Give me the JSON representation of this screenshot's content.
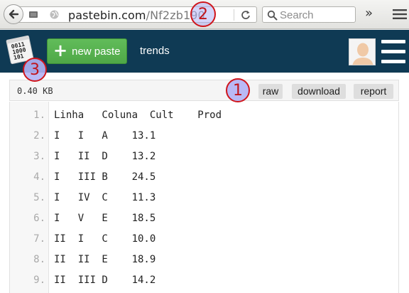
{
  "browser": {
    "url_domain": "pastebin.com",
    "url_path": "/Nf2zb190",
    "search_placeholder": "Search",
    "overflow_label": "»"
  },
  "header": {
    "new_paste_label": "new paste",
    "trends_label": "trends"
  },
  "paste": {
    "size": "0.40 KB",
    "buttons": {
      "raw": "raw",
      "download": "download",
      "report": "report"
    },
    "lines": [
      {
        "n": "1.",
        "text": "Linha   Coluna  Cult    Prod"
      },
      {
        "n": "2.",
        "text": "I   I   A    13.1"
      },
      {
        "n": "3.",
        "text": "I   II  D    13.2"
      },
      {
        "n": "4.",
        "text": "I   III B    24.5"
      },
      {
        "n": "5.",
        "text": "I   IV  C    11.3"
      },
      {
        "n": "6.",
        "text": "I   V   E    18.5"
      },
      {
        "n": "7.",
        "text": "II  I   C    10.0"
      },
      {
        "n": "8.",
        "text": "II  II  E    18.9"
      },
      {
        "n": "9.",
        "text": "II  III D    14.2"
      }
    ]
  },
  "callouts": {
    "one": "1",
    "two": "2",
    "three": "3"
  },
  "colors": {
    "header_bg": "#0f3a54",
    "new_paste_green": "#57b04f",
    "callout_red": "#d0151b",
    "callout_fill": "#b2b2f5"
  }
}
